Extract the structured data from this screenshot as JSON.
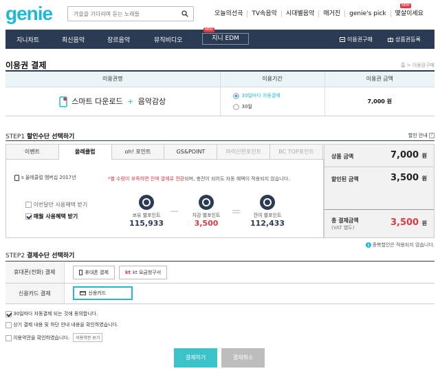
{
  "header": {
    "logo": "genie",
    "search_placeholder": "가을을 기다리며 듣는 노래들",
    "top_links": [
      "오늘의선곡",
      "TV속음악",
      "시대별음악",
      "매거진",
      "genie's pick",
      "몇살이세요"
    ],
    "new_badge": "NEW"
  },
  "nav": {
    "items": [
      "지니차트",
      "최신음악",
      "장르음악",
      "뮤직비디오"
    ],
    "edm": "지니 EDM",
    "right": [
      "이용권구매",
      "상품권등록"
    ]
  },
  "page": {
    "title": "이용권 결제",
    "breadcrumb": "홈 > 이용권구매"
  },
  "product_table": {
    "headers": [
      "이용권명",
      "이용기간",
      "이용권 금액"
    ],
    "name": "스마트 다운로드",
    "plus": "+",
    "name2": "음악감상",
    "period_options": [
      "30일마다 자동결제",
      "30일"
    ],
    "price": "7,000 원"
  },
  "step1": {
    "step_label": "STEP1",
    "title": "할인수단 선택하기",
    "help": "할인 안내",
    "tabs": [
      "이벤트",
      "올레클럽",
      "oh! 포인트",
      "GS&POINT",
      "마이신한포인트",
      "BC TOP포인트"
    ],
    "card_info": "s 올레클럽 멤버십 2017년",
    "warning_red": "*별 수량이 부족하면 전액 결제로 전환",
    "warning_rest": "되며, 충전이 되어도 자동 혜택이 적용되지 않습니다.",
    "opt_monthly": "이번달만 사용혜택 받기",
    "opt_always": "매월 사용혜택 받기",
    "points": [
      {
        "label": "보유 별포인트",
        "value": "115,933"
      },
      {
        "label": "차감 별포인트",
        "value": "3,500"
      },
      {
        "label": "잔여 별포인트",
        "value": "112,433"
      }
    ],
    "op_minus": "−",
    "op_equal": "=",
    "summary": {
      "product_label": "상품 금액",
      "product_value": "7,000",
      "discount_label": "할인된 금액",
      "discount_value": "3,500",
      "total_label": "총 결제금액",
      "total_sub": "(VAT 별도)",
      "total_value": "3,500",
      "won": "원"
    },
    "note": "중복할인은 적용되지 않습니다."
  },
  "step2": {
    "step_label": "STEP2",
    "title": "결제수단 선택하기",
    "rows": [
      {
        "label": "휴대폰(전화) 결제",
        "options": [
          "휴대폰 결제",
          "kt 요금청구서"
        ]
      },
      {
        "label": "신용카드 결제",
        "options": [
          "신용카드"
        ]
      }
    ]
  },
  "agreements": [
    "30일마다 자동결제 되는 것에 동의합니다.",
    "상기 결제 내용 및 하단 안내 내용을 확인하였습니다.",
    "이용약관을 확인하였습니다."
  ],
  "terms_button": "이용약관 보기",
  "buttons": {
    "pay": "결제하기",
    "cancel": "결제취소"
  },
  "colors": {
    "accent": "#1fb9d3",
    "nav": "#2b3b53",
    "red": "#e2383f"
  }
}
